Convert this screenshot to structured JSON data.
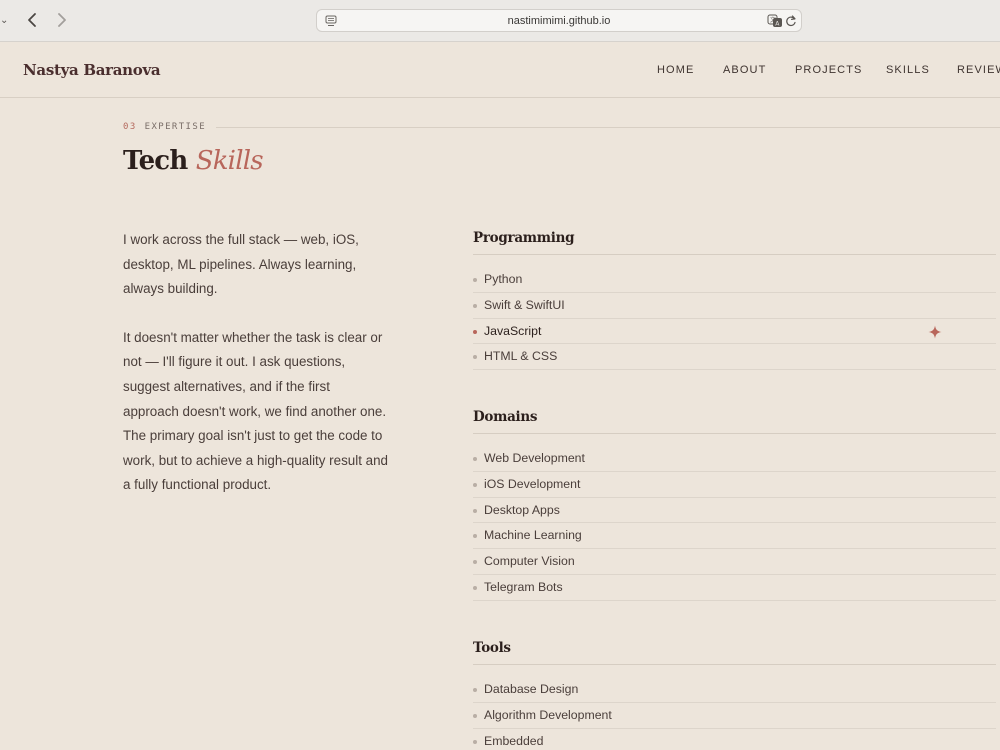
{
  "browser": {
    "url": "nastimimimi.github.io"
  },
  "site": {
    "logo": "Nastya Baranova",
    "nav": [
      {
        "label": "HOME"
      },
      {
        "label": "ABOUT"
      },
      {
        "label": "PROJECTS"
      },
      {
        "label": "SKILLS"
      },
      {
        "label": "REVIEW"
      }
    ]
  },
  "section": {
    "number": "03",
    "eyebrow": "EXPERTISE",
    "title": "Tech",
    "title_accent": "Skills"
  },
  "intro": {
    "paragraphs": [
      "I work across the full stack — web, iOS, desktop, ML pipelines. Always learning, always building.",
      "It doesn't matter whether the task is clear or not — I'll figure it out. I ask questions, suggest alternatives, and if the first approach doesn't work, we find another one. The primary goal isn't just to get the code to work, but to achieve a high-quality result and a fully functional product."
    ]
  },
  "skill_groups": [
    {
      "title": "Programming",
      "items": [
        "Python",
        "Swift & SwiftUI",
        "JavaScript",
        "HTML & CSS"
      ],
      "active_item": "JavaScript"
    },
    {
      "title": "Domains",
      "items": [
        "Web Development",
        "iOS Development",
        "Desktop Apps",
        "Machine Learning",
        "Computer Vision",
        "Telegram Bots"
      ]
    },
    {
      "title": "Tools",
      "items": [
        "Database Design",
        "Algorithm Development",
        "Embedded"
      ]
    }
  ],
  "colors": {
    "background": "#ede5db",
    "accent": "#b8665b",
    "heading": "#2b1f1c"
  }
}
